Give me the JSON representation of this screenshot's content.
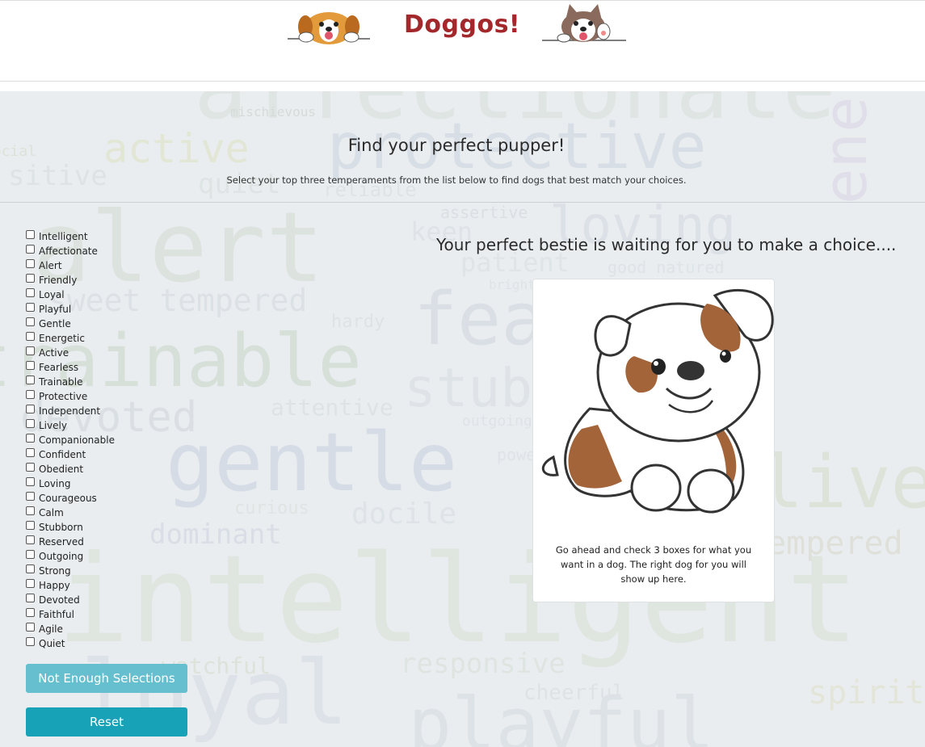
{
  "header": {
    "brand": "Doggos!",
    "logos": [
      "beagle-logo",
      "husky-logo"
    ]
  },
  "hero": {
    "title": "Find your perfect pupper!",
    "subtitle": "Select your top three temperaments from the list below to find dogs that best match your choices."
  },
  "temperaments": [
    "Intelligent",
    "Affectionate",
    "Alert",
    "Friendly",
    "Loyal",
    "Playful",
    "Gentle",
    "Energetic",
    "Active",
    "Fearless",
    "Trainable",
    "Protective",
    "Independent",
    "Lively",
    "Companionable",
    "Confident",
    "Obedient",
    "Loving",
    "Courageous",
    "Calm",
    "Stubborn",
    "Reserved",
    "Outgoing",
    "Strong",
    "Happy",
    "Devoted",
    "Faithful",
    "Agile",
    "Quiet"
  ],
  "buttons": {
    "submit_label": "Not Enough Selections",
    "reset_label": "Reset"
  },
  "result": {
    "heading": "Your perfect bestie is waiting for you to make a choice....",
    "card_text": "Go ahead and check 3 boxes for what you want in a dog. The right dog for you will show up here.",
    "image": "bulldog-puppy-illustration"
  },
  "word_cloud": [
    {
      "w": "affectionate"
    },
    {
      "w": "mischievous"
    },
    {
      "w": "social"
    },
    {
      "w": "active"
    },
    {
      "w": "protective"
    },
    {
      "w": "sitive"
    },
    {
      "w": "quiet"
    },
    {
      "w": "reliable"
    },
    {
      "w": "assertive"
    },
    {
      "w": "alert"
    },
    {
      "w": "keen"
    },
    {
      "w": "loving"
    },
    {
      "w": "patient"
    },
    {
      "w": "good natured"
    },
    {
      "w": "bright"
    },
    {
      "w": "sweet tempered"
    },
    {
      "w": "hardy"
    },
    {
      "w": "fearless"
    },
    {
      "w": "trainable"
    },
    {
      "w": "stubborn"
    },
    {
      "w": "devoted"
    },
    {
      "w": "attentive"
    },
    {
      "w": "gentle"
    },
    {
      "w": "energetic"
    },
    {
      "w": "curious"
    },
    {
      "w": "docile"
    },
    {
      "w": "dominant"
    },
    {
      "w": "intelligent"
    },
    {
      "w": "loyal"
    },
    {
      "w": "responsive"
    },
    {
      "w": "watchful"
    },
    {
      "w": "cheerful"
    },
    {
      "w": "playful"
    },
    {
      "w": "lively"
    },
    {
      "w": "tempered"
    },
    {
      "w": "spirited"
    },
    {
      "w": "outgoing"
    },
    {
      "w": "powerful"
    }
  ],
  "colors": {
    "brand": "#a3282b",
    "button_disabled": "#66bfcf",
    "button_reset": "#17a2b8",
    "background": "#e9edf0"
  }
}
